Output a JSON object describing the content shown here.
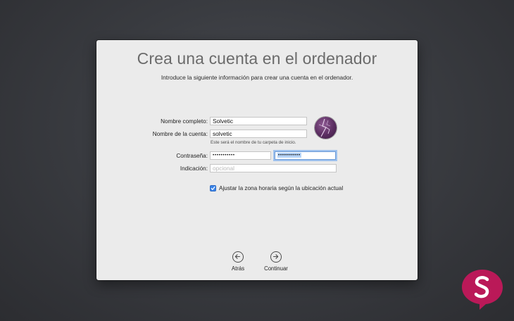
{
  "dialog": {
    "title": "Crea una cuenta en el ordenador",
    "subtitle": "Introduce la siguiente información para crear una cuenta en el ordenador."
  },
  "form": {
    "full_name_label": "Nombre completo:",
    "full_name_value": "Solvetic",
    "account_name_label": "Nombre de la cuenta:",
    "account_name_value": "solvetic",
    "account_hint": "Este será el nombre de tu carpeta de inicio.",
    "password_label": "Contraseña:",
    "password_value": "•••••••••••",
    "password_verify_value": "•••••••••••",
    "hint_label": "Indicación:",
    "hint_placeholder": "opcional",
    "timezone_checkbox_label": "Ajustar la zona horaria según la ubicación actual",
    "timezone_checked": true
  },
  "nav": {
    "back_label": "Atrás",
    "continue_label": "Continuar"
  },
  "colors": {
    "accent": "#3b84e8",
    "focus_ring": "#9fc2ee",
    "watermark": "#c2185b"
  },
  "icons": {
    "avatar": "lightning-avatar-icon",
    "back": "arrow-left-circle-icon",
    "continue": "arrow-right-circle-icon",
    "watermark": "solvetic-logo-icon"
  }
}
